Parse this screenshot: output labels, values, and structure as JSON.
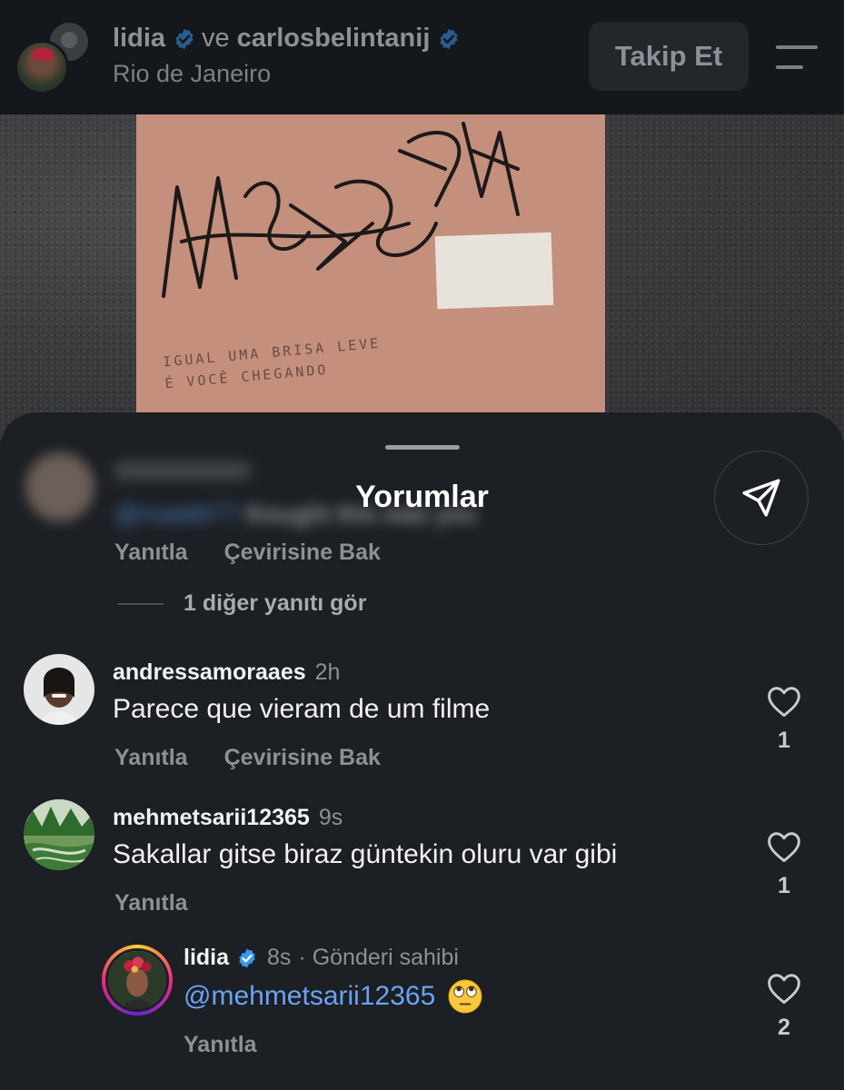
{
  "header": {
    "user1": "lidia",
    "joiner": "ve",
    "user2": "carlosbelintanij",
    "location": "Rio de Janeiro",
    "follow_label": "Takip Et"
  },
  "photo": {
    "line1": "IGUAL UMA BRISA LEVE",
    "line2": "É VOCÊ CHEGANDO"
  },
  "sheet": {
    "title": "Yorumlar"
  },
  "top_comment": {
    "text_mention": "@maddi77",
    "text": " thought this was you",
    "reply_label": "Yanıtla",
    "translate_label": "Çevirisine Bak",
    "more_replies": "1 diğer yanıtı gör"
  },
  "comments": [
    {
      "user": "andressamoraaes",
      "time": "2h",
      "text": "Parece que vieram de um filme",
      "reply_label": "Yanıtla",
      "translate_label": "Çevirisine Bak",
      "likes": "1"
    },
    {
      "user": "mehmetsarii12365",
      "time": "9s",
      "text": "Sakallar gitse biraz güntekin oluru var gibi",
      "reply_label": "Yanıtla",
      "likes": "1"
    },
    {
      "user": "lidia",
      "time": "8s",
      "owner_label": "· Gönderi sahibi",
      "mention": "@mehmetsarii12365",
      "reply_label": "Yanıtla",
      "likes": "2"
    }
  ],
  "colors": {
    "background": "#1c1f24",
    "header_bg": "#14171b",
    "mention": "#6aa3f5",
    "verified": "#3897f0",
    "muted_text": "#8d9096"
  },
  "icons": [
    "verified-badge-icon",
    "menu-icon",
    "send-icon",
    "heart-icon",
    "eye-roll-emoji"
  ]
}
